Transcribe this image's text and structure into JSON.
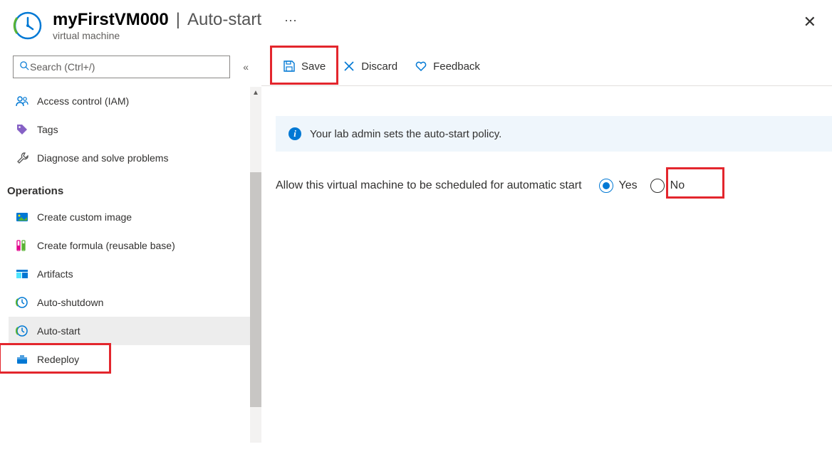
{
  "header": {
    "title": "myFirstVM000",
    "section": "Auto-start",
    "subtitle": "virtual machine"
  },
  "sidebar": {
    "search_placeholder": "Search (Ctrl+/)",
    "top_items": [
      {
        "label": "Access control (IAM)"
      },
      {
        "label": "Tags"
      },
      {
        "label": "Diagnose and solve problems"
      }
    ],
    "group_heading": "Operations",
    "operations_items": [
      {
        "label": "Create custom image"
      },
      {
        "label": "Create formula (reusable base)"
      },
      {
        "label": "Artifacts"
      },
      {
        "label": "Auto-shutdown"
      },
      {
        "label": "Auto-start",
        "selected": true
      },
      {
        "label": "Redeploy"
      }
    ]
  },
  "toolbar": {
    "save_label": "Save",
    "discard_label": "Discard",
    "feedback_label": "Feedback"
  },
  "banner": {
    "text": "Your lab admin sets the auto-start policy."
  },
  "setting": {
    "label": "Allow this virtual machine to be scheduled for automatic start",
    "option_yes": "Yes",
    "option_no": "No",
    "value": "Yes"
  }
}
